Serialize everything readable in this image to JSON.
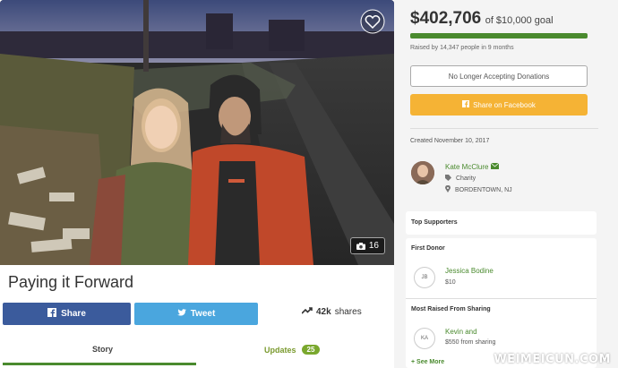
{
  "campaign": {
    "title": "Paying it Forward",
    "photo_count": "16",
    "photo_description_icon": "camera-icon"
  },
  "social": {
    "share_label": "Share",
    "tweet_label": "Tweet",
    "shares_count": "42k",
    "shares_label": "shares"
  },
  "tabs": {
    "story_label": "Story",
    "updates_label": "Updates",
    "updates_count": "25"
  },
  "funding": {
    "amount": "$402,706",
    "goal_text": "of $10,000 goal",
    "progress": 1.0,
    "raised_text": "Raised by 14,347 people in 9 months",
    "no_longer_label": "No Longer Accepting Donations",
    "share_facebook_label": "Share on Facebook"
  },
  "organizer": {
    "created": "Created November 10, 2017",
    "name": "Kate McClure",
    "category": "Charity",
    "location": "BORDENTOWN, NJ"
  },
  "supporters": {
    "top_heading": "Top Supporters",
    "first_donor_heading": "First Donor",
    "first_donor_initials": "JB",
    "first_donor_name": "Jessica Bodine",
    "first_donor_amount": "$10",
    "most_raised_heading": "Most Raised From Sharing",
    "sharer_initials": "KA",
    "sharer_name": "Kevin and",
    "sharer_amount": "$550 from sharing",
    "see_more": "+ See More"
  },
  "watermark": "WEIMEICUN.COM",
  "colors": {
    "green": "#4a8a2e",
    "facebook_blue": "#3b5b9c",
    "twitter_blue": "#4aa6de",
    "orange": "#f5b335"
  }
}
